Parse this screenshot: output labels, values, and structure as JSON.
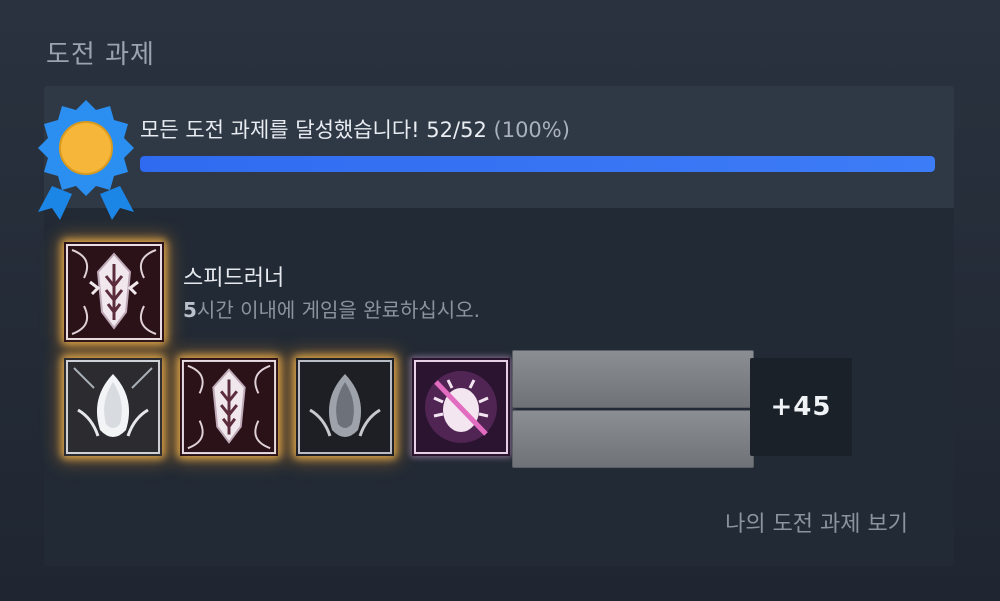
{
  "section_title": "도전 과제",
  "summary": {
    "message": "모든 도전 과제를 달성했습니다!",
    "count": "52/52",
    "percent": "(100%)",
    "progress": 1.0,
    "badge_icon": "ribbon-medal-icon",
    "colors": {
      "badge_blue": "#1c86e6",
      "badge_gold": "#f5b63a",
      "progress_blue": "#3d7cf7"
    }
  },
  "featured": {
    "name": "스피드러너",
    "desc_prefix": "5",
    "desc_rest": "시간 이내에 게임을 완료하십시오.",
    "icon": "speedrunner-achievement-icon"
  },
  "achievement_row": {
    "icons": [
      "white-silk-achievement-icon",
      "speedrunner-achievement-icon",
      "dark-silk-achievement-icon",
      "bug-crossed-achievement-icon"
    ],
    "more_label": "+45"
  },
  "view_link": "나의 도전 과제 보기",
  "colors": {
    "glow": "#ffbe50",
    "panel": "#222a35",
    "summary_bg": "#2f3845"
  }
}
